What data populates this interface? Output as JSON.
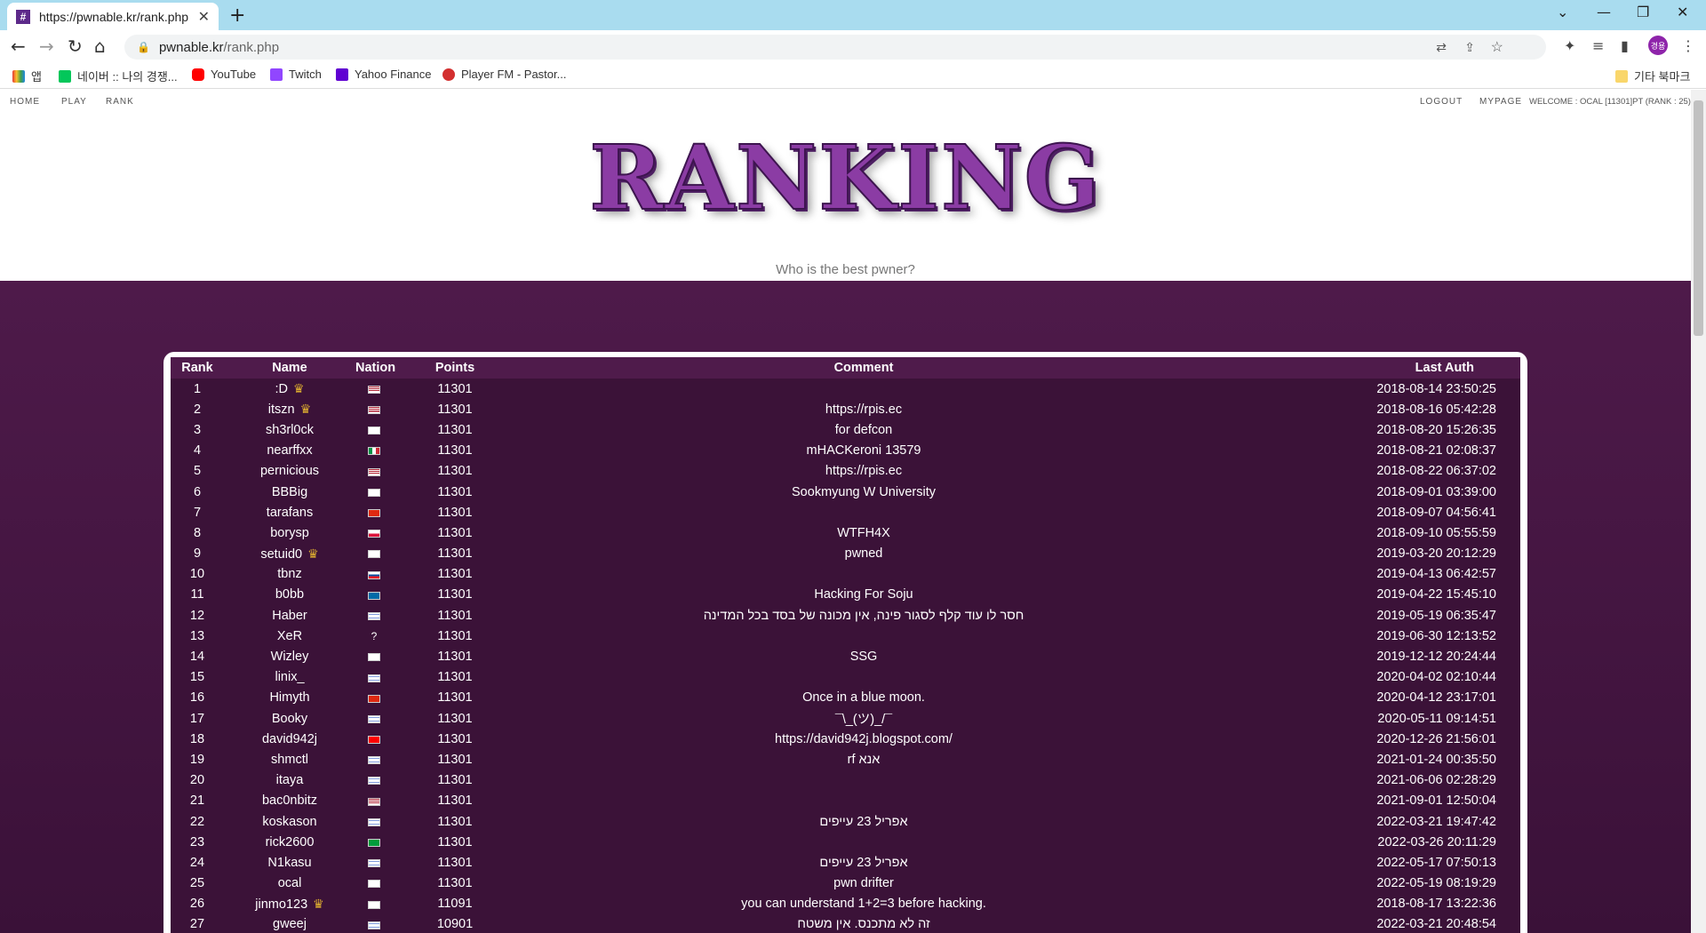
{
  "browser": {
    "tab_title": "https://pwnable.kr/rank.php",
    "tab_favicon": "#",
    "url_host": "pwnable.kr",
    "url_path": "/rank.php",
    "avatar_text": "경용",
    "bookmarks": [
      {
        "label": "앱",
        "icon": "apps-icon",
        "color": "#e53935"
      },
      {
        "label": "네이버 :: 나의 경쟁...",
        "icon": "naver-icon",
        "color": "#03c75a"
      },
      {
        "label": "YouTube",
        "icon": "youtube-icon",
        "color": "#ff0000"
      },
      {
        "label": "Twitch",
        "icon": "twitch-icon",
        "color": "#9146ff"
      },
      {
        "label": "Yahoo Finance",
        "icon": "yahoo-icon",
        "color": "#6001d2"
      },
      {
        "label": "Player FM - Pastor...",
        "icon": "playerfm-icon",
        "color": "#d32f2f"
      }
    ],
    "other_bookmarks": "기타 북마크"
  },
  "nav": {
    "home": "HOME",
    "play": "PLAY",
    "rank": "RANK",
    "logout": "LOGOUT",
    "mypage": "MYPAGE",
    "welcome": "WELCOME : OCAL [11301]PT (RANK : 25)"
  },
  "header": {
    "logo": "RANKING",
    "subtitle": "Who is the best pwner?"
  },
  "table": {
    "columns": [
      "Rank",
      "Name",
      "Nation",
      "Points",
      "Comment",
      "Last Auth"
    ],
    "rows": [
      {
        "rank": "1",
        "name": ":D",
        "crown": true,
        "flag": "us",
        "points": "11301",
        "comment": "",
        "auth": "2018-08-14 23:50:25"
      },
      {
        "rank": "2",
        "name": "itszn",
        "crown": true,
        "flag": "us",
        "points": "11301",
        "comment": "https://rpis.ec",
        "auth": "2018-08-16 05:42:28"
      },
      {
        "rank": "3",
        "name": "sh3rl0ck",
        "crown": false,
        "flag": "kr",
        "points": "11301",
        "comment": "for defcon",
        "auth": "2018-08-20 15:26:35"
      },
      {
        "rank": "4",
        "name": "nearffxx",
        "crown": false,
        "flag": "it",
        "points": "11301",
        "comment": "mHACKeroni 13579",
        "auth": "2018-08-21 02:08:37"
      },
      {
        "rank": "5",
        "name": "pernicious",
        "crown": false,
        "flag": "us",
        "points": "11301",
        "comment": "https://rpis.ec",
        "auth": "2018-08-22 06:37:02"
      },
      {
        "rank": "6",
        "name": "BBBig",
        "crown": false,
        "flag": "kr",
        "points": "11301",
        "comment": "Sookmyung W University",
        "auth": "2018-09-01 03:39:00"
      },
      {
        "rank": "7",
        "name": "tarafans",
        "crown": false,
        "flag": "cn",
        "points": "11301",
        "comment": "",
        "auth": "2018-09-07 04:56:41"
      },
      {
        "rank": "8",
        "name": "borysp",
        "crown": false,
        "flag": "pl",
        "points": "11301",
        "comment": "WTFH4X",
        "auth": "2018-09-10 05:55:59"
      },
      {
        "rank": "9",
        "name": "setuid0",
        "crown": true,
        "flag": "kr",
        "points": "11301",
        "comment": "pwned",
        "auth": "2019-03-20 20:12:29"
      },
      {
        "rank": "10",
        "name": "tbnz",
        "crown": false,
        "flag": "sk",
        "points": "11301",
        "comment": "",
        "auth": "2019-04-13 06:42:57"
      },
      {
        "rank": "11",
        "name": "b0bb",
        "crown": false,
        "flag": "se",
        "points": "11301",
        "comment": "Hacking For Soju",
        "auth": "2019-04-22 15:45:10"
      },
      {
        "rank": "12",
        "name": "Haber",
        "crown": false,
        "flag": "il",
        "points": "11301",
        "comment": "חסר לו עוד קלף לסגור פינה, אין מכונה של בסד בכל המדינה",
        "auth": "2019-05-19 06:35:47"
      },
      {
        "rank": "13",
        "name": "XeR",
        "crown": false,
        "flag": "?",
        "points": "11301",
        "comment": "",
        "auth": "2019-06-30 12:13:52"
      },
      {
        "rank": "14",
        "name": "Wizley",
        "crown": false,
        "flag": "kr",
        "points": "11301",
        "comment": "SSG",
        "auth": "2019-12-12 20:24:44"
      },
      {
        "rank": "15",
        "name": "linix_",
        "crown": false,
        "flag": "il",
        "points": "11301",
        "comment": "",
        "auth": "2020-04-02 02:10:44"
      },
      {
        "rank": "16",
        "name": "Himyth",
        "crown": false,
        "flag": "cn",
        "points": "11301",
        "comment": "Once in a blue moon.",
        "auth": "2020-04-12 23:17:01"
      },
      {
        "rank": "17",
        "name": "Booky",
        "crown": false,
        "flag": "il",
        "points": "11301",
        "comment": "¯\\_(ツ)_/¯",
        "auth": "2020-05-11 09:14:51"
      },
      {
        "rank": "18",
        "name": "david942j",
        "crown": false,
        "flag": "tw",
        "points": "11301",
        "comment": "https://david942j.blogspot.com/",
        "auth": "2020-12-26 21:56:01"
      },
      {
        "rank": "19",
        "name": "shmctl",
        "crown": false,
        "flag": "il",
        "points": "11301",
        "comment": "rf אנא",
        "auth": "2021-01-24 00:35:50"
      },
      {
        "rank": "20",
        "name": "itaya",
        "crown": false,
        "flag": "il",
        "points": "11301",
        "comment": "",
        "auth": "2021-06-06 02:28:29"
      },
      {
        "rank": "21",
        "name": "bac0nbitz",
        "crown": false,
        "flag": "us",
        "points": "11301",
        "comment": "",
        "auth": "2021-09-01 12:50:04"
      },
      {
        "rank": "22",
        "name": "koskason",
        "crown": false,
        "flag": "il",
        "points": "11301",
        "comment": "אפריל 23 עייפים",
        "auth": "2022-03-21 19:47:42"
      },
      {
        "rank": "23",
        "name": "rick2600",
        "crown": false,
        "flag": "br",
        "points": "11301",
        "comment": "",
        "auth": "2022-03-26 20:11:29"
      },
      {
        "rank": "24",
        "name": "N1kasu",
        "crown": false,
        "flag": "il",
        "points": "11301",
        "comment": "אפריל 23 עייפים",
        "auth": "2022-05-17 07:50:13"
      },
      {
        "rank": "25",
        "name": "ocal",
        "crown": false,
        "flag": "kr",
        "points": "11301",
        "comment": "pwn drifter",
        "auth": "2022-05-19 08:19:29"
      },
      {
        "rank": "26",
        "name": "jinmo123",
        "crown": true,
        "flag": "kr",
        "points": "11091",
        "comment": "you can understand 1+2=3 before hacking.",
        "auth": "2018-08-17 13:22:36"
      },
      {
        "rank": "27",
        "name": "gweej",
        "crown": false,
        "flag": "il",
        "points": "10901",
        "comment": "זה לא מתכנס. אין משטח",
        "auth": "2022-03-21 20:48:54"
      }
    ]
  },
  "colors": {
    "accent": "#8b3ca4",
    "panel_bg": "#3b1238",
    "page_bg": "#4e1a4a",
    "crown": "#e0b030"
  }
}
